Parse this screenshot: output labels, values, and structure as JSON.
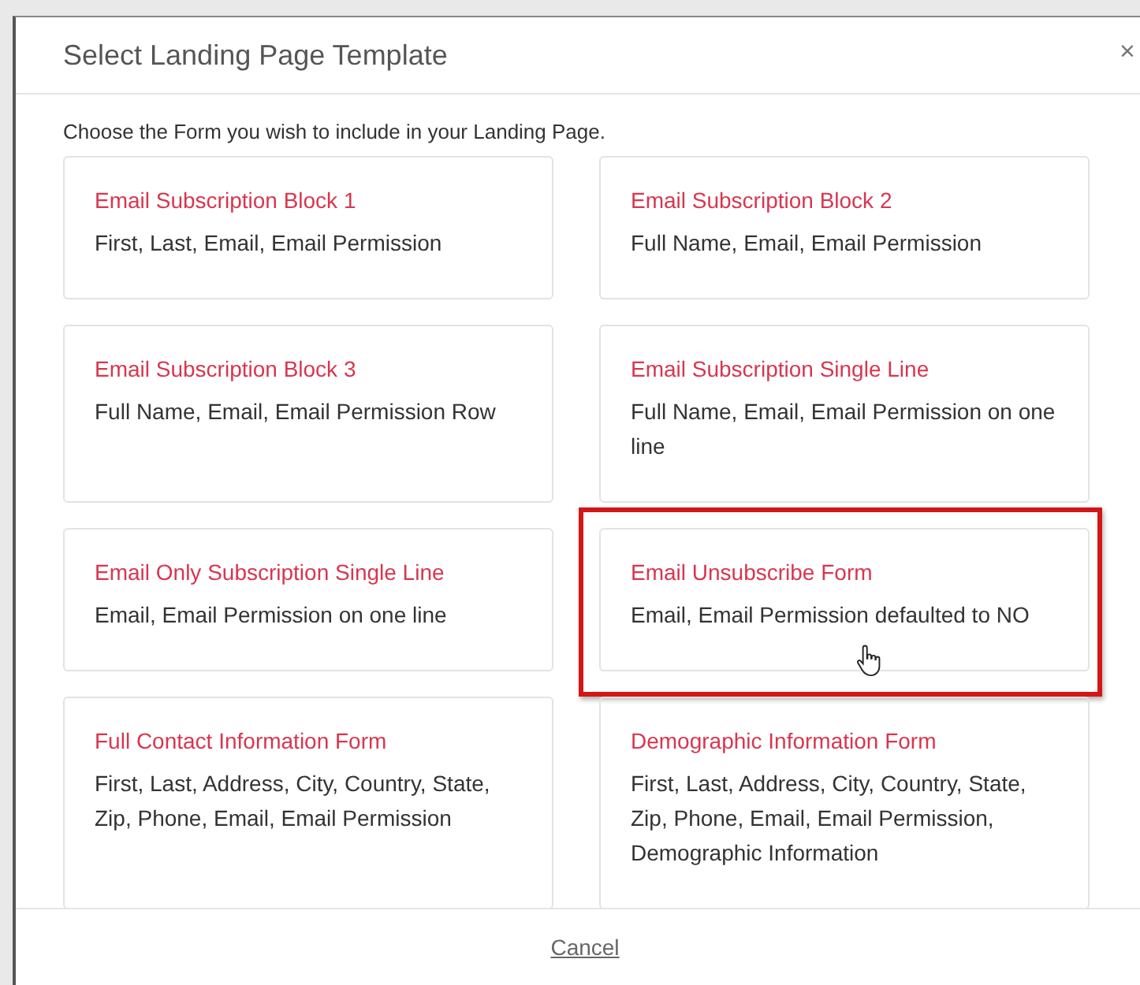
{
  "dialog": {
    "title": "Select Landing Page Template",
    "close": "×",
    "intro": "Choose the Form you wish to include in your Landing Page.",
    "templates": [
      {
        "title": "Email Subscription Block 1",
        "fields": "First, Last, Email, Email Permission",
        "highlighted": false
      },
      {
        "title": "Email Subscription Block 2",
        "fields": "Full Name, Email, Email Permission",
        "highlighted": false
      },
      {
        "title": "Email Subscription Block 3",
        "fields": "Full Name, Email, Email Permission Row",
        "highlighted": false
      },
      {
        "title": "Email Subscription Single Line",
        "fields": "Full Name, Email, Email Permission on one line",
        "highlighted": false
      },
      {
        "title": "Email Only Subscription Single Line",
        "fields": "Email, Email Permission on one line",
        "highlighted": false
      },
      {
        "title": "Email Unsubscribe Form",
        "fields": "Email, Email Permission defaulted to NO",
        "highlighted": true
      },
      {
        "title": "Full Contact Information Form",
        "fields": "First, Last, Address, City, Country, State, Zip, Phone, Email, Email Permission",
        "highlighted": false
      },
      {
        "title": "Demographic Information Form",
        "fields": "First, Last, Address, City, Country, State, Zip, Phone, Email, Email Permission, Demographic Information",
        "highlighted": false
      }
    ],
    "cancel": "Cancel"
  }
}
